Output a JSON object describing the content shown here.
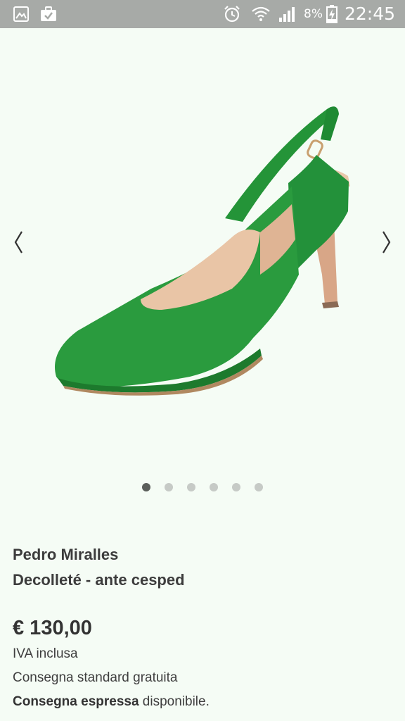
{
  "status_bar": {
    "battery_percent": "8%",
    "time": "22:45",
    "icons": [
      "gallery-icon",
      "bag-check-icon",
      "alarm-icon",
      "wifi-icon",
      "signal-icon",
      "battery-charging-icon"
    ]
  },
  "gallery": {
    "prev_icon": "chevron-left-icon",
    "next_icon": "chevron-right-icon",
    "total_images": 6,
    "active_index": 0,
    "product_colors": {
      "upper": "#2a9a3c",
      "upper_dark": "#1d7a2b",
      "lining": "#e8c5a8",
      "heel": "#d9a98a"
    }
  },
  "product": {
    "brand": "Pedro Miralles",
    "name": "Decolleté - ante cesped",
    "price": "€ 130,00",
    "vat": "IVA inclusa",
    "shipping": "Consegna standard gratuita",
    "express_bold": "Consegna espressa",
    "express_rest": " disponibile."
  }
}
